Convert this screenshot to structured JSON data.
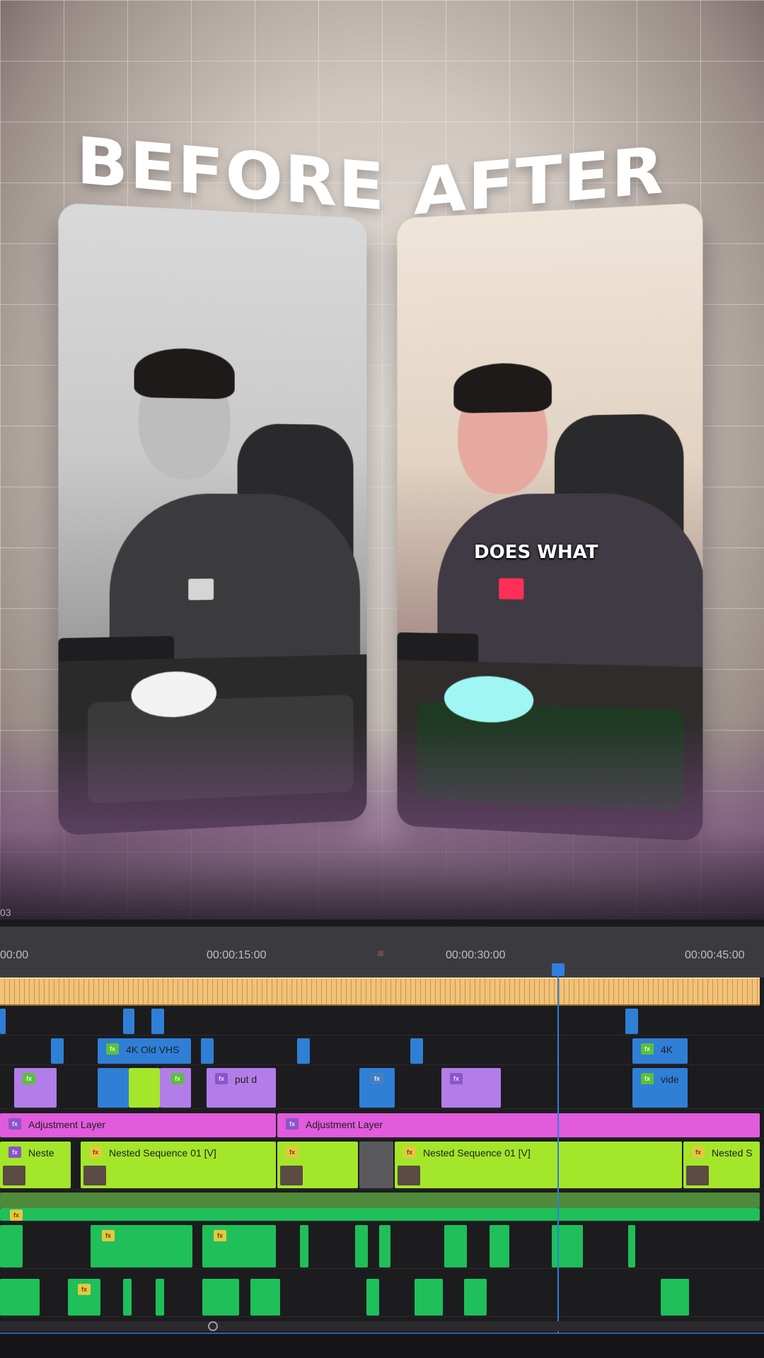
{
  "preview": {
    "title_before": "BEFORE",
    "title_after": "AFTER",
    "caption": "DOES WHAT",
    "timecode_fragment": "03"
  },
  "timeline": {
    "ruler": [
      "00:00",
      "00:00:15:00",
      "00:00:30:00",
      "00:00:45:00"
    ],
    "clips": {
      "v5_4k_old_vhs": "4K Old VHS",
      "v5_4k": "4K",
      "v4_put_d": "put d",
      "v4_vide": "vide",
      "v3_adjustment_a": "Adjustment Layer",
      "v3_adjustment_b": "Adjustment Layer",
      "v2_neste": "Neste",
      "v2_nested_a": "Nested Sequence 01 [V]",
      "v2_nested_b": "Nested Sequence 01 [V]",
      "v2_nested_c": "Nested S"
    },
    "colors": {
      "playhead": "#2f7fe0",
      "adjustment": "#e15bdc",
      "nested": "#a4e62a",
      "audio": "#1fbf5a"
    }
  },
  "icons": [
    "fx-badge-icon",
    "playhead-icon",
    "zoom-knob-icon"
  ]
}
